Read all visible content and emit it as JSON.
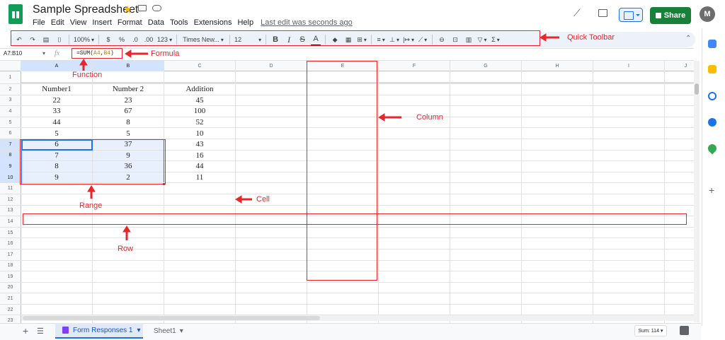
{
  "header": {
    "doc_title": "Sample Spreadsheet",
    "menus": [
      "File",
      "Edit",
      "View",
      "Insert",
      "Format",
      "Data",
      "Tools",
      "Extensions",
      "Help"
    ],
    "last_edit": "Last edit was seconds ago",
    "share_label": "Share",
    "avatar_letter": "M"
  },
  "toolbar": {
    "zoom": "100%",
    "currency": "$",
    "percent": "%",
    "dec_decrease": ".0",
    "dec_increase": ".00",
    "format_more": "123",
    "font": "Times New...",
    "font_size": "12",
    "bold": "B",
    "italic": "I",
    "strike": "S",
    "text_color": "A",
    "sum_symbol": "Σ"
  },
  "formula_bar": {
    "name_box": "A7:B10",
    "fx": "fx",
    "formula_prefix": "=SUM(",
    "formula_ref1": "A4",
    "formula_sep": ",",
    "formula_ref2": "B4",
    "formula_suffix": ")"
  },
  "grid": {
    "columns": [
      "A",
      "B",
      "C",
      "D",
      "E",
      "F",
      "G",
      "H",
      "I",
      "J"
    ],
    "row_numbers": [
      "1",
      "2",
      "3",
      "4",
      "5",
      "6",
      "7",
      "8",
      "9",
      "10",
      "11",
      "12",
      "13",
      "14",
      "15",
      "16",
      "17",
      "18",
      "19",
      "20",
      "21",
      "22",
      "23"
    ],
    "cells": [
      [
        "",
        "",
        ""
      ],
      [
        "Number1",
        "Number 2",
        "Addition"
      ],
      [
        "22",
        "23",
        "45"
      ],
      [
        "33",
        "67",
        "100"
      ],
      [
        "44",
        "8",
        "52"
      ],
      [
        "5",
        "5",
        "10"
      ],
      [
        "6",
        "37",
        "43"
      ],
      [
        "7",
        "9",
        "16"
      ],
      [
        "8",
        "36",
        "44"
      ],
      [
        "9",
        "2",
        "11"
      ]
    ]
  },
  "sheets": {
    "active_tab": "Form Responses 1",
    "other_tab": "Sheet1"
  },
  "status": {
    "sum": "Sum: 114"
  },
  "annotations": {
    "quick_toolbar": "Quick Toolbar",
    "formula": "Formula",
    "function": "Function",
    "column": "Column",
    "cell": "Cell",
    "range": "Range",
    "row": "Row"
  },
  "colors": {
    "annotation_red": "#e8262c",
    "selection_blue": "#1a73e8",
    "share_green": "#188038",
    "sheets_green": "#0f9d58"
  }
}
